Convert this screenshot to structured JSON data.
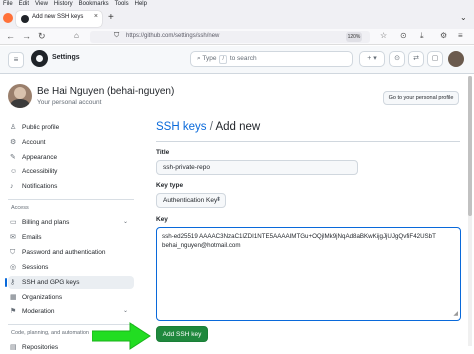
{
  "browser": {
    "menu": [
      "File",
      "Edit",
      "View",
      "History",
      "Bookmarks",
      "Tools",
      "Help"
    ],
    "tab_title": "Add new SSH keys",
    "tab_close": "×",
    "new_tab": "+",
    "url": "https://github.com/settings/ssh/new",
    "zoom": "120%"
  },
  "header": {
    "title": "Settings",
    "search_placeholder_pre": "Type",
    "search_key": "/",
    "search_placeholder_post": "to search",
    "add_label": "+ ▾"
  },
  "user": {
    "name": "Be Hai Nguyen (behai-nguyen)",
    "subtitle": "Your personal account",
    "go_profile": "Go to your personal profile"
  },
  "sidebar": {
    "items_top": [
      {
        "label": "Public profile",
        "icon": "person-icon"
      },
      {
        "label": "Account",
        "icon": "gear-icon"
      },
      {
        "label": "Appearance",
        "icon": "paintbrush-icon"
      },
      {
        "label": "Accessibility",
        "icon": "accessibility-icon"
      },
      {
        "label": "Notifications",
        "icon": "bell-icon"
      }
    ],
    "access_header": "Access",
    "items_access": [
      {
        "label": "Billing and plans",
        "icon": "credit-card-icon"
      },
      {
        "label": "Emails",
        "icon": "mail-icon"
      },
      {
        "label": "Password and authentication",
        "icon": "shield-lock-icon"
      },
      {
        "label": "Sessions",
        "icon": "broadcast-icon"
      },
      {
        "label": "SSH and GPG keys",
        "icon": "key-icon"
      },
      {
        "label": "Organizations",
        "icon": "organization-icon"
      },
      {
        "label": "Moderation",
        "icon": "report-icon"
      }
    ],
    "code_header": "Code, planning, and automation",
    "items_code": [
      {
        "label": "Repositories",
        "icon": "repo-icon"
      }
    ]
  },
  "main": {
    "crumb_link": "SSH keys",
    "crumb_sep": "/",
    "crumb_current": "Add new",
    "title_label": "Title",
    "title_value": "ssh-private-repo",
    "keytype_label": "Key type",
    "keytype_value": "Authentication Key",
    "key_label": "Key",
    "key_line1": "ssh-ed25519 AAAAC3NzaC1lZDI1NTE5AAAAIMTGu+OQjlMk9jNqAd8aBKwKijgJjUJgQvfiF42USbT",
    "key_line2": "behai_nguyen@hotmail.com",
    "add_button": "Add SSH key"
  },
  "colors": {
    "accent": "#0969da",
    "primary_button": "#1f883d",
    "annotation_arrow": "#22dd22"
  }
}
